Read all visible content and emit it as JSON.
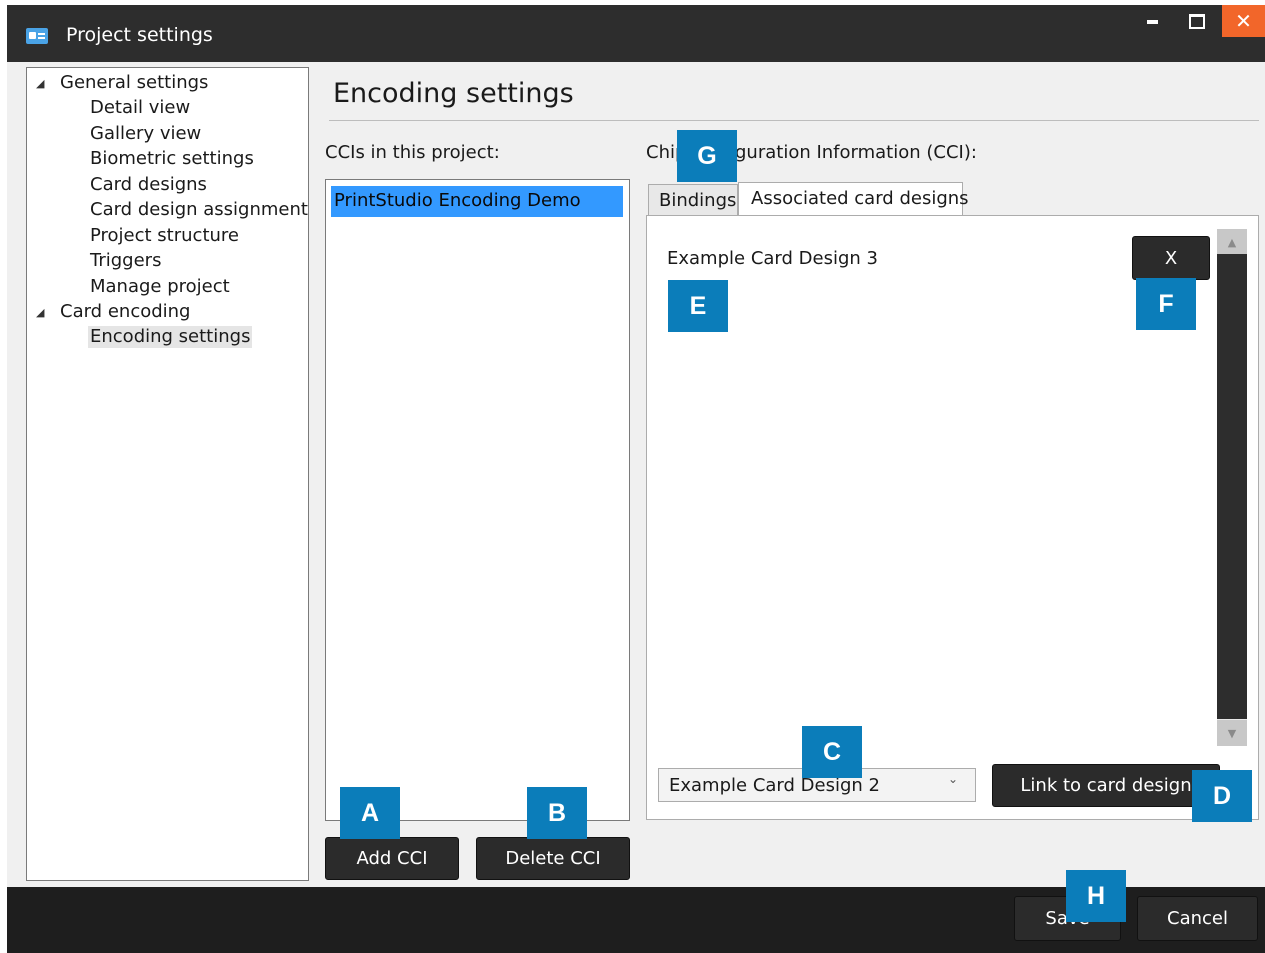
{
  "window": {
    "title": "Project settings",
    "controls": {
      "minimize": "minimize",
      "maximize": "maximize",
      "close": "✕"
    }
  },
  "tree": {
    "groups": [
      {
        "label": "General settings",
        "items": [
          "Detail view",
          "Gallery view",
          "Biometric settings",
          "Card designs",
          "Card design assignment",
          "Project structure",
          "Triggers",
          "Manage project"
        ]
      },
      {
        "label": "Card encoding",
        "items": [
          "Encoding settings"
        ]
      }
    ],
    "selected": "Encoding settings"
  },
  "main": {
    "heading": "Encoding settings",
    "ccis_label": "CCIs in this project:",
    "ccis": [
      "PrintStudio Encoding Demo"
    ],
    "cci_label_left": "Chip",
    "cci_label_right": "guration Information (CCI):",
    "tabs": [
      {
        "label": "Bindings",
        "active": false
      },
      {
        "label": "Associated card designs",
        "active": true
      }
    ],
    "associated_designs": [
      "Example Card Design 3"
    ],
    "remove_label": "X",
    "design_select": {
      "value": "Example Card Design 2"
    },
    "link_label": "Link to card design",
    "add_cci_label": "Add CCI",
    "delete_cci_label": "Delete CCI"
  },
  "footer": {
    "save_label": "Save",
    "cancel_label": "Cancel"
  },
  "callouts": {
    "a": "A",
    "b": "B",
    "c": "C",
    "d": "D",
    "e": "E",
    "f": "F",
    "g": "G",
    "h": "H"
  },
  "colors": {
    "titlebar": "#2d2d2d",
    "close_button": "#f2662a",
    "selection": "#3399ff",
    "callout": "#0b7dba",
    "dark_button": "#2b2b2b"
  }
}
